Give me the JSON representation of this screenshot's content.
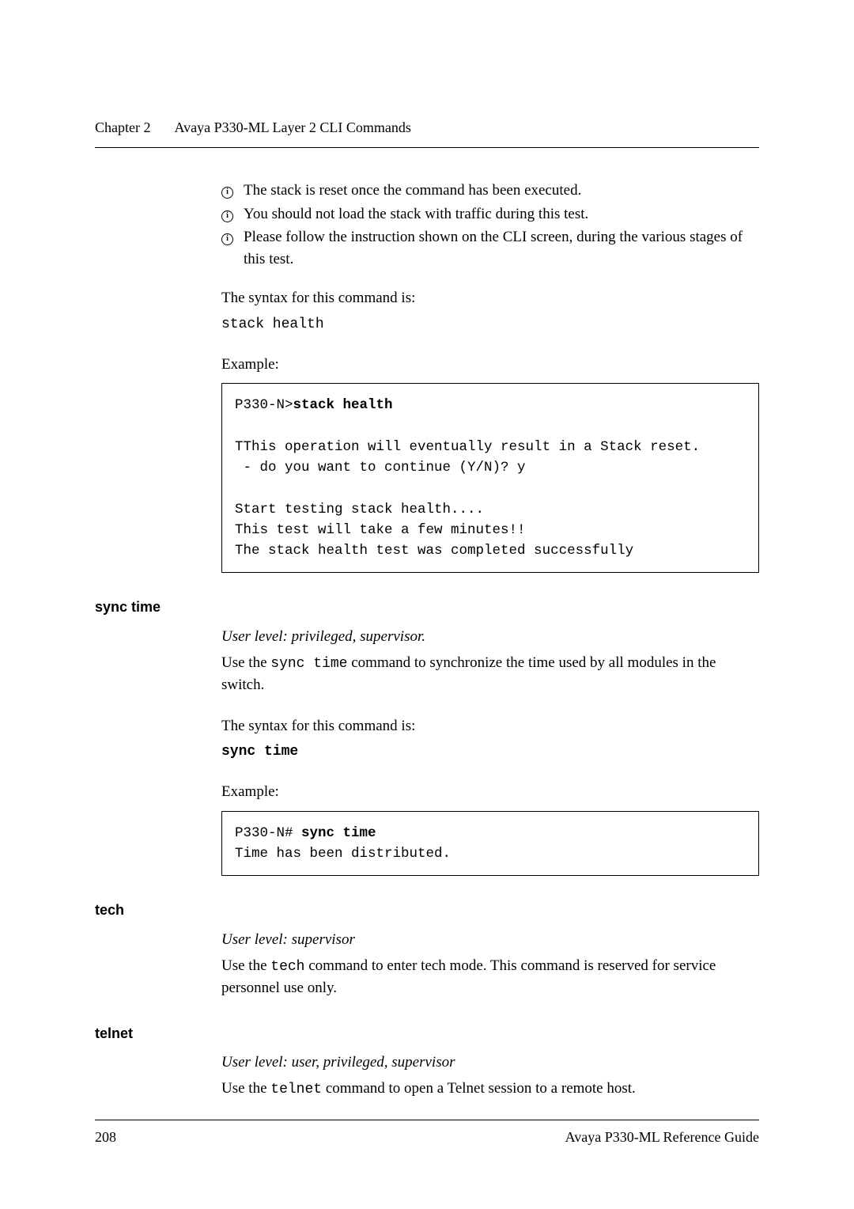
{
  "header": {
    "chapter": "Chapter 2",
    "title": "Avaya P330-ML Layer 2 CLI Commands"
  },
  "bullets": [
    "The stack is reset once the command has been executed.",
    "You should not load the stack with traffic during this test.",
    "Please follow the instruction shown on the CLI screen, during the various stages of this test."
  ],
  "syntax_intro": "The syntax for this command is:",
  "syntax1": "stack health",
  "example_label": "Example:",
  "example1_prompt": "P330-N>",
  "example1_cmd": "stack health",
  "example1_body": "TThis operation will eventually result in a Stack reset.\n - do you want to continue (Y/N)? y\n\nStart testing stack health....\nThis test will take a few minutes!!\nThe stack health test was completed successfully",
  "sync": {
    "heading": "sync time",
    "userlevel": "User level: privileged, supervisor.",
    "desc_pre": "Use the ",
    "desc_cmd": "sync time",
    "desc_post": " command to synchronize the time used by all modules in the switch.",
    "syntax_cmd": "sync time",
    "ex_prompt": "P330-N# ",
    "ex_cmd": "sync time",
    "ex_body": "Time has been distributed."
  },
  "tech": {
    "heading": "tech",
    "userlevel": "User level: supervisor",
    "desc_pre": "Use the ",
    "desc_cmd": "tech",
    "desc_post": " command to enter tech mode. This command is reserved for service personnel use only."
  },
  "telnet": {
    "heading": "telnet",
    "userlevel": "User level: user, privileged, supervisor",
    "desc_pre": "Use the ",
    "desc_cmd": "telnet",
    "desc_post": " command to open a Telnet session to a remote host."
  },
  "footer": {
    "page": "208",
    "doc": "Avaya P330-ML Reference Guide"
  }
}
